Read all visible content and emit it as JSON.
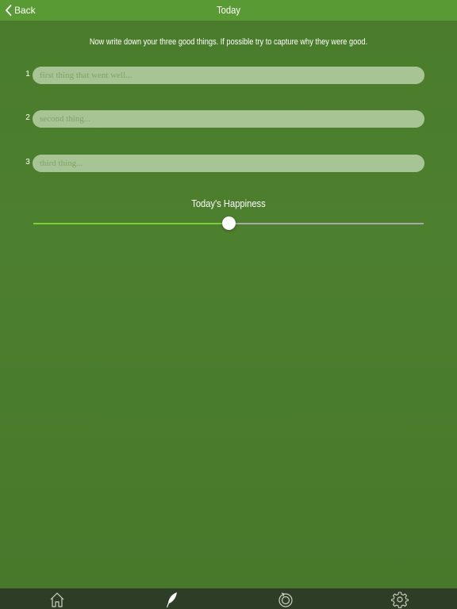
{
  "nav": {
    "back_label": "Back",
    "title": "Today"
  },
  "instructions": "Now write down your three good things. If possible try to capture why they were good.",
  "things": [
    {
      "number": "1",
      "value": "",
      "placeholder": "first thing that went well..."
    },
    {
      "number": "2",
      "value": "",
      "placeholder": "second thing..."
    },
    {
      "number": "3",
      "value": "",
      "placeholder": "third thing..."
    }
  ],
  "happiness": {
    "label": "Today's Happiness",
    "value": 0.5
  },
  "tabs": [
    {
      "icon": "home-icon"
    },
    {
      "icon": "quill-icon",
      "selected": true
    },
    {
      "icon": "history-icon"
    },
    {
      "icon": "gear-icon"
    }
  ],
  "colors": {
    "background": "#4a7c2b",
    "navbar": "#5a9a35",
    "input": "#a7c494",
    "slider_fill": "#7cd037",
    "tabbar": "#2e3d26"
  }
}
